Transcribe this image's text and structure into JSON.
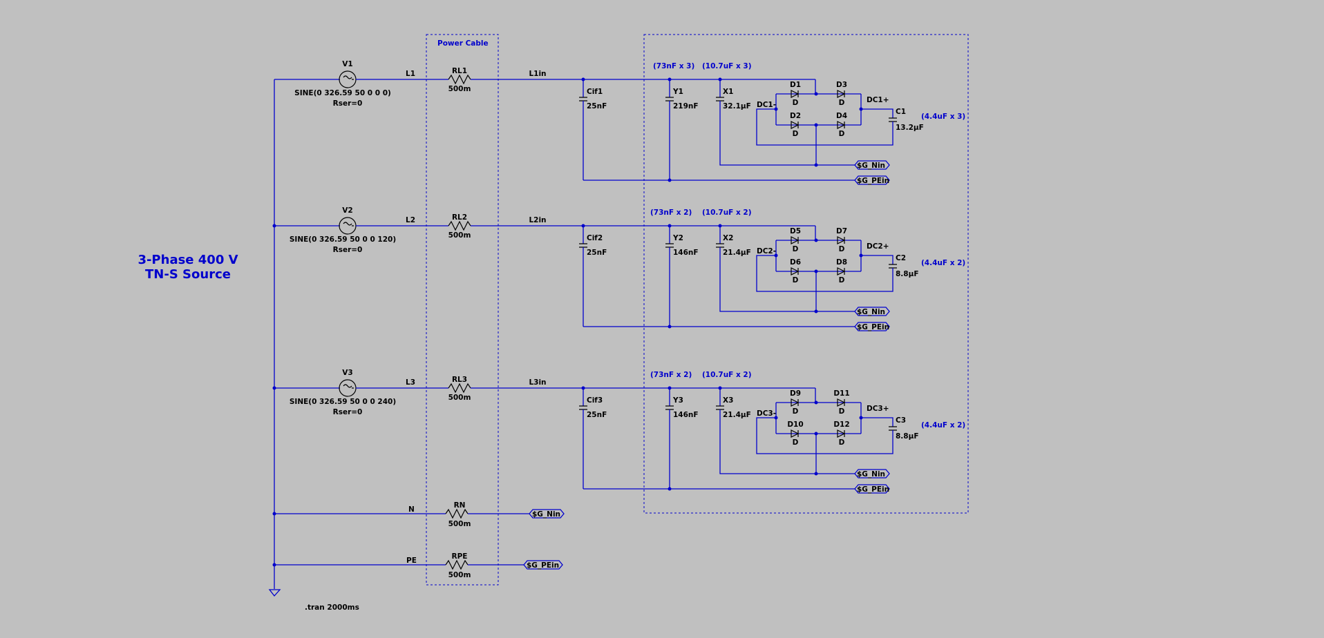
{
  "title": {
    "line1": "3-Phase 400 V",
    "line2": "TN-S Source"
  },
  "cable_box_label": "Power Cable",
  "tran": ".tran 2000ms",
  "sources": [
    {
      "name": "V1",
      "value": "SINE(0 326.59 50 0 0 0)",
      "rser": "Rser=0",
      "net": "L1"
    },
    {
      "name": "V2",
      "value": "SINE(0 326.59 50 0 0 120)",
      "rser": "Rser=0",
      "net": "L2"
    },
    {
      "name": "V3",
      "value": "SINE(0 326.59 50 0 0 240)",
      "rser": "Rser=0",
      "net": "L3"
    }
  ],
  "cable_resistors": [
    {
      "name": "RL1",
      "value": "500m",
      "out_net": "L1in"
    },
    {
      "name": "RL2",
      "value": "500m",
      "out_net": "L2in"
    },
    {
      "name": "RL3",
      "value": "500m",
      "out_net": "L3in"
    }
  ],
  "neutral": {
    "net": "N",
    "name": "RN",
    "value": "500m",
    "flag": "$G_Nin"
  },
  "earth": {
    "net": "PE",
    "name": "RPE",
    "value": "500m",
    "flag": "$G_PEin"
  },
  "stages": [
    {
      "cif": {
        "name": "Cif1",
        "value": "25nF"
      },
      "y": {
        "name": "Y1",
        "value": "219nF",
        "note": "(73nF x 3)"
      },
      "x": {
        "name": "X1",
        "value": "32.1µF",
        "note": "(10.7uF x 3)"
      },
      "diodes": [
        {
          "name": "D1",
          "model": "D"
        },
        {
          "name": "D3",
          "model": "D"
        },
        {
          "name": "D2",
          "model": "D"
        },
        {
          "name": "D4",
          "model": "D"
        }
      ],
      "dcm": "DC1-",
      "dcp": "DC1+",
      "c": {
        "name": "C1",
        "value": "13.2µF",
        "note": "(4.4uF x 3)"
      },
      "flag_n": "$G_Nin",
      "flag_pe": "$G_PEin"
    },
    {
      "cif": {
        "name": "Cif2",
        "value": "25nF"
      },
      "y": {
        "name": "Y2",
        "value": "146nF",
        "note": "(73nF x 2)"
      },
      "x": {
        "name": "X2",
        "value": "21.4µF",
        "note": "(10.7uF x 2)"
      },
      "diodes": [
        {
          "name": "D5",
          "model": "D"
        },
        {
          "name": "D7",
          "model": "D"
        },
        {
          "name": "D6",
          "model": "D"
        },
        {
          "name": "D8",
          "model": "D"
        }
      ],
      "dcm": "DC2-",
      "dcp": "DC2+",
      "c": {
        "name": "C2",
        "value": "8.8µF",
        "note": "(4.4uF x 2)"
      },
      "flag_n": "$G_Nin",
      "flag_pe": "$G_PEin"
    },
    {
      "cif": {
        "name": "Cif3",
        "value": "25nF"
      },
      "y": {
        "name": "Y3",
        "value": "146nF",
        "note": "(73nF x 2)"
      },
      "x": {
        "name": "X3",
        "value": "21.4µF",
        "note": "(10.7uF x 2)"
      },
      "diodes": [
        {
          "name": "D9",
          "model": "D"
        },
        {
          "name": "D11",
          "model": "D"
        },
        {
          "name": "D10",
          "model": "D"
        },
        {
          "name": "D12",
          "model": "D"
        }
      ],
      "dcm": "DC3-",
      "dcp": "DC3+",
      "c": {
        "name": "C3",
        "value": "8.8µF",
        "note": "(4.4uF x 2)"
      },
      "flag_n": "$G_Nin",
      "flag_pe": "$G_PEin"
    }
  ]
}
